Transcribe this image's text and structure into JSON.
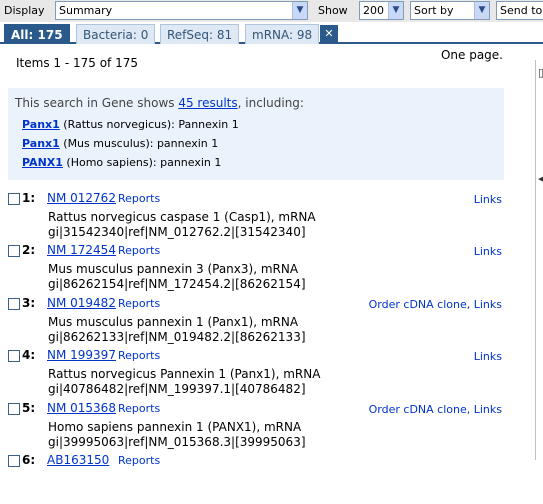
{
  "toolbar": {
    "display_label": "Display",
    "display_value": "Summary",
    "show_label": "Show",
    "show_value": "200",
    "sort_value": "Sort by",
    "send_value": "Send to"
  },
  "tabs": [
    {
      "label": "All: 175"
    },
    {
      "label": "Bacteria: 0"
    },
    {
      "label": "RefSeq: 81"
    },
    {
      "label": "mRNA: 98"
    }
  ],
  "items_text": "Items 1 - 175 of 175",
  "one_page": "One page.",
  "gene": {
    "prefix": "This search in Gene shows ",
    "link": "45 results",
    "suffix": ", including:",
    "rows": [
      {
        "symbol": "Panx1",
        "rest": " (Rattus norvegicus): Pannexin 1"
      },
      {
        "symbol": "Panx1",
        "rest": " (Mus musculus): pannexin 1"
      },
      {
        "symbol": "PANX1",
        "rest": " (Homo sapiens): pannexin 1"
      }
    ]
  },
  "results": [
    {
      "num": "1:",
      "acc": "NM 012762",
      "reports": "Reports",
      "links": "Links",
      "title": "Rattus norvegicus caspase 1 (Casp1), mRNA",
      "gi": "gi|31542340|ref|NM_012762.2|[31542340]"
    },
    {
      "num": "2:",
      "acc": "NM 172454",
      "reports": "Reports",
      "links": "Links",
      "title": "Mus musculus pannexin 3 (Panx3), mRNA",
      "gi": "gi|86262154|ref|NM_172454.2|[86262154]"
    },
    {
      "num": "3:",
      "acc": "NM 019482",
      "reports": "Reports",
      "links": "Order cDNA clone,  Links",
      "title": "Mus musculus pannexin 1 (Panx1), mRNA",
      "gi": "gi|86262133|ref|NM_019482.2|[86262133]"
    },
    {
      "num": "4:",
      "acc": "NM 199397",
      "reports": "Reports",
      "links": "Links",
      "title": "Rattus norvegicus Pannexin 1 (Panx1), mRNA",
      "gi": "gi|40786482|ref|NM_199397.1|[40786482]"
    },
    {
      "num": "5:",
      "acc": "NM 015368",
      "reports": "Reports",
      "links": "Order cDNA clone,  Links",
      "title": "Homo sapiens pannexin 1 (PANX1), mRNA",
      "gi": "gi|39995063|ref|NM_015368.3|[39995063]"
    },
    {
      "num": "6:",
      "acc": "AB163150",
      "reports": "Reports",
      "links": "",
      "title": "",
      "gi": ""
    }
  ]
}
